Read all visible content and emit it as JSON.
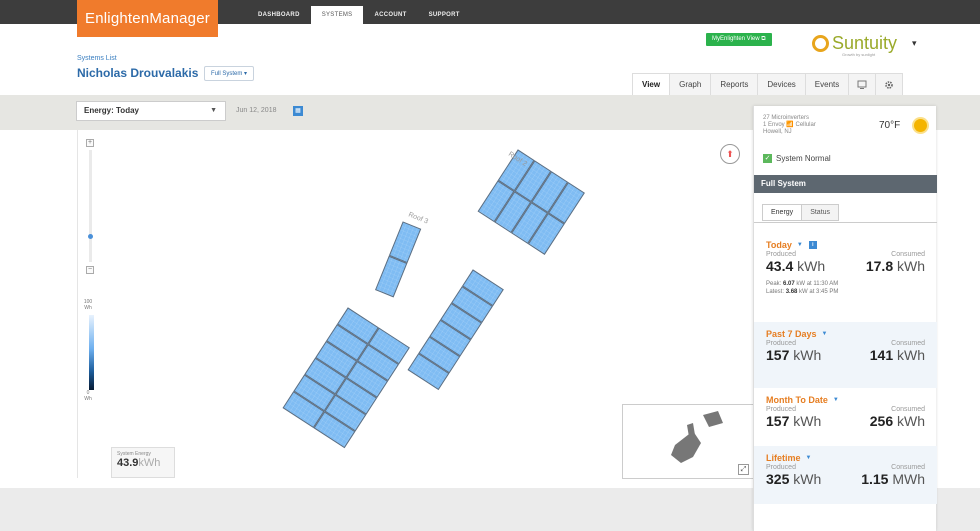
{
  "app": {
    "logo": "EnlightenManager"
  },
  "nav": {
    "tabs": [
      "DASHBOARD",
      "SYSTEMS",
      "ACCOUNT",
      "SUPPORT"
    ],
    "active": "SYSTEMS"
  },
  "topright": {
    "my_enlighten": "MyEnlighten View ⧉",
    "brand": "Suntuity",
    "brand_tagline": "Growth by sunlight",
    "menu_caret": "▾"
  },
  "header": {
    "breadcrumb": "Systems List",
    "owner": "Nicholas Drouvalakis",
    "system_selector": "Full System ▾"
  },
  "view_tabs": {
    "view": "View",
    "graph": "Graph",
    "reports": "Reports",
    "devices": "Devices",
    "events": "Events",
    "monitor_icon": "monitor-icon",
    "gear_icon": "gear-icon"
  },
  "toolbar": {
    "energy_select": "Energy: Today",
    "date": "Jun 12, 2018"
  },
  "map": {
    "roof_labels": [
      "Roof 2",
      "Roof 3"
    ],
    "zoom_in": "+",
    "zoom_out": "−",
    "legend_max": "100",
    "legend_max_unit": "Wh",
    "legend_min": "0",
    "legend_min_unit": "Wh",
    "system_energy_label": "System Energy",
    "system_energy_value": "43.9",
    "system_energy_unit": "kWh"
  },
  "panel": {
    "weather_lines": [
      "27 Microinverters",
      "1 Envoy 📶 Cellular",
      "Howell, NJ"
    ],
    "temperature": "70°F",
    "status": "System Normal",
    "header": "Full System",
    "tabs": [
      "Energy",
      "Status"
    ],
    "sections": [
      {
        "title": "Today",
        "produced_label": "Produced",
        "consumed_label": "Consumed",
        "produced": "43.4",
        "produced_unit": "kWh",
        "consumed": "17.8",
        "consumed_unit": "kWh",
        "peak_prefix": "Peak:",
        "peak_value": "6.07",
        "peak_suffix": "kW at 11:30 AM",
        "latest_prefix": "Latest:",
        "latest_value": "3.68",
        "latest_suffix": "kW at 3:45 PM"
      },
      {
        "title": "Past 7 Days",
        "produced_label": "Produced",
        "consumed_label": "Consumed",
        "produced": "157",
        "produced_unit": "kWh",
        "consumed": "141",
        "consumed_unit": "kWh"
      },
      {
        "title": "Month To Date",
        "produced_label": "Produced",
        "consumed_label": "Consumed",
        "produced": "157",
        "produced_unit": "kWh",
        "consumed": "256",
        "consumed_unit": "kWh"
      },
      {
        "title": "Lifetime",
        "produced_label": "Produced",
        "consumed_label": "Consumed",
        "produced": "325",
        "produced_unit": "kWh",
        "consumed": "1.15",
        "consumed_unit": "MWh"
      }
    ]
  },
  "colors": {
    "brand_orange": "#f07b2c",
    "nav_dark": "#3d3d3d",
    "panel_blue": "#6fb0ef",
    "accent_orange": "#e67e22"
  }
}
